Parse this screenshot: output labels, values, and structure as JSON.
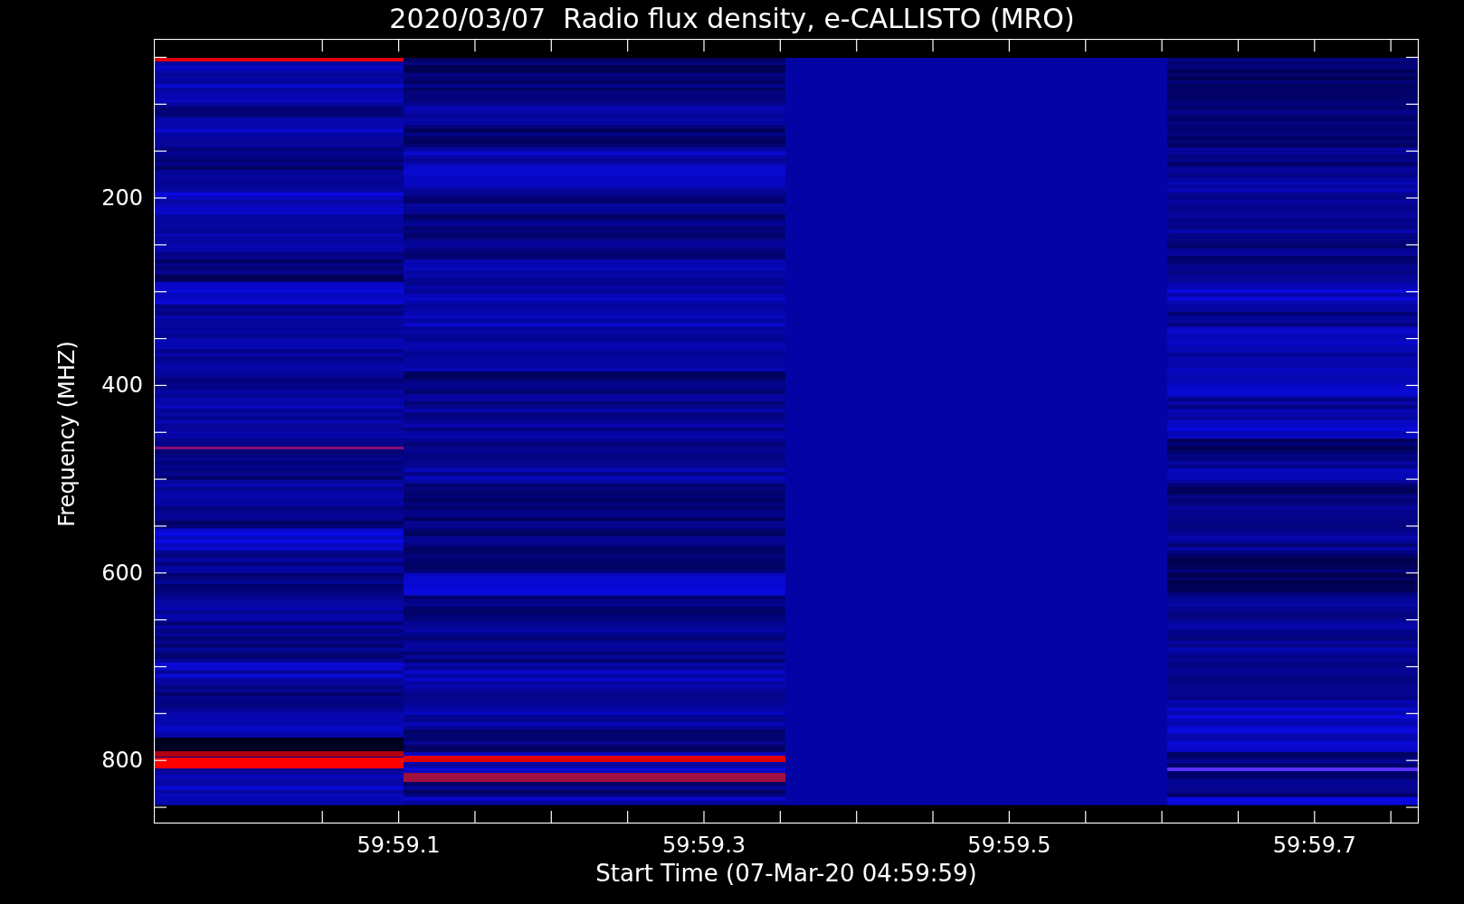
{
  "plot": {
    "title": "2020/03/07  Radio flux density, e-CALLISTO (MRO)",
    "ylabel": "Frequency (MHZ)",
    "xlabel": "Start Time (07-Mar-20 04:59:59)",
    "yticks": [
      "200",
      "400",
      "600",
      "800"
    ],
    "xticks": [
      "59:59.1",
      "59:59.3",
      "59:59.5",
      "59:59.7"
    ]
  }
}
